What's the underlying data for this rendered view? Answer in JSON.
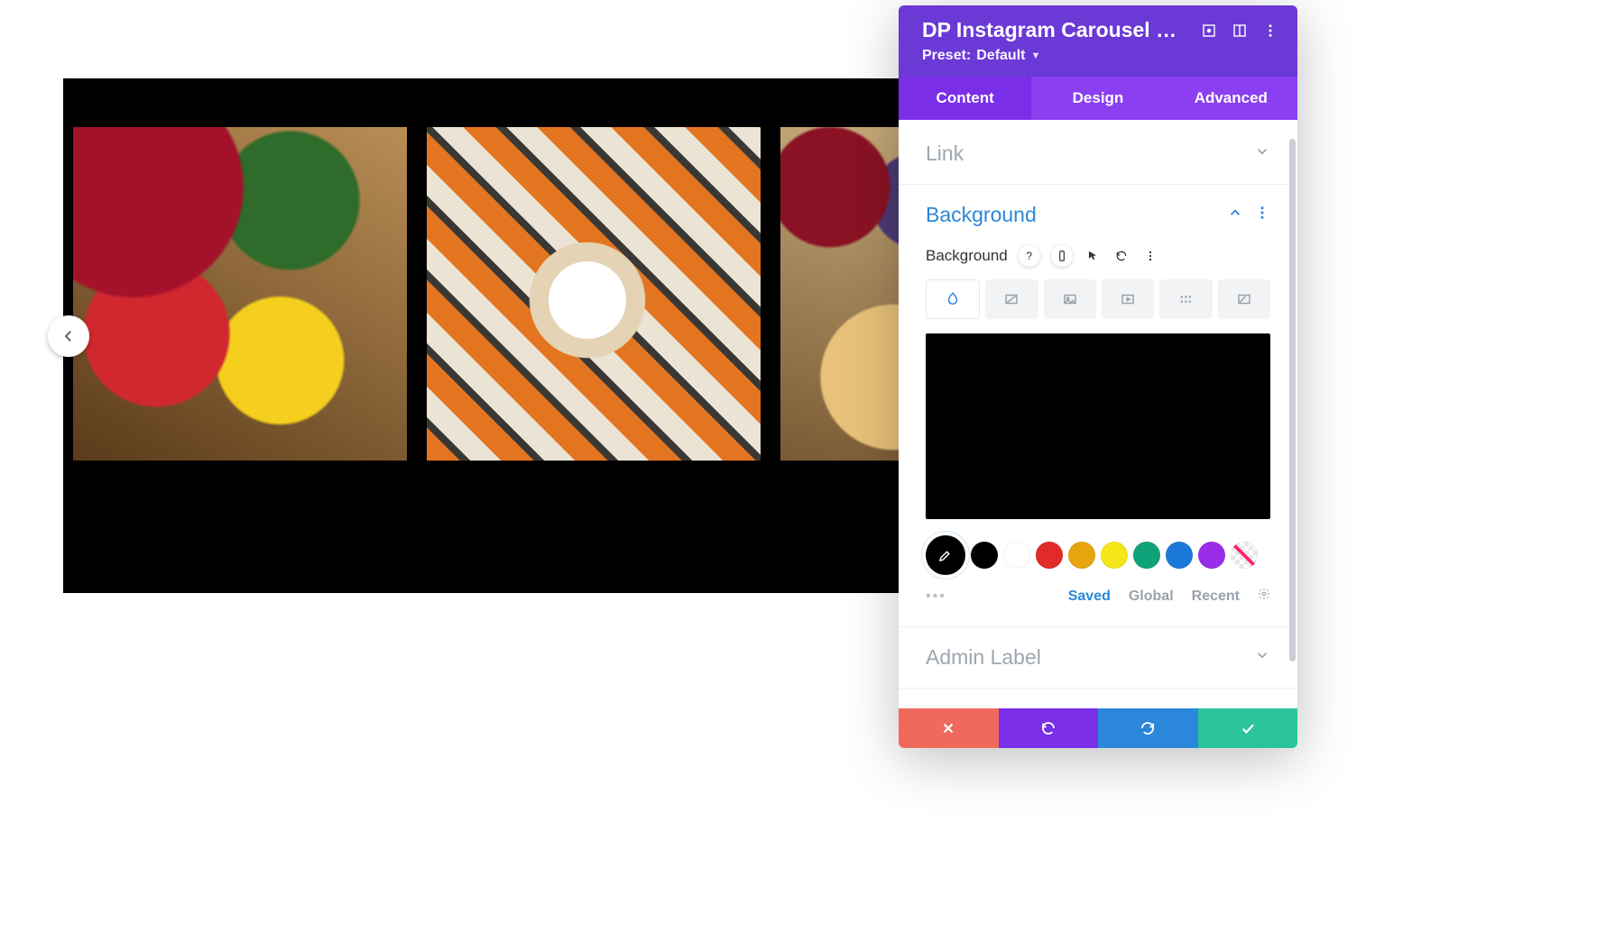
{
  "panel": {
    "title": "DP Instagram Carousel Setti…",
    "preset_prefix": "Preset:",
    "preset_value": "Default"
  },
  "tabs": {
    "content": "Content",
    "design": "Design",
    "advanced": "Advanced"
  },
  "sections": {
    "link": "Link",
    "background": "Background",
    "admin_label": "Admin Label"
  },
  "bg": {
    "label": "Background",
    "swatch_color": "#000000",
    "palette": [
      "#000000",
      "#ffffff",
      "#e12a2a",
      "#e6a50f",
      "#f5e61a",
      "#10a37a",
      "#1d79d8",
      "#9a2ee8"
    ],
    "footer_tabs": {
      "saved": "Saved",
      "global": "Global",
      "recent": "Recent"
    }
  }
}
